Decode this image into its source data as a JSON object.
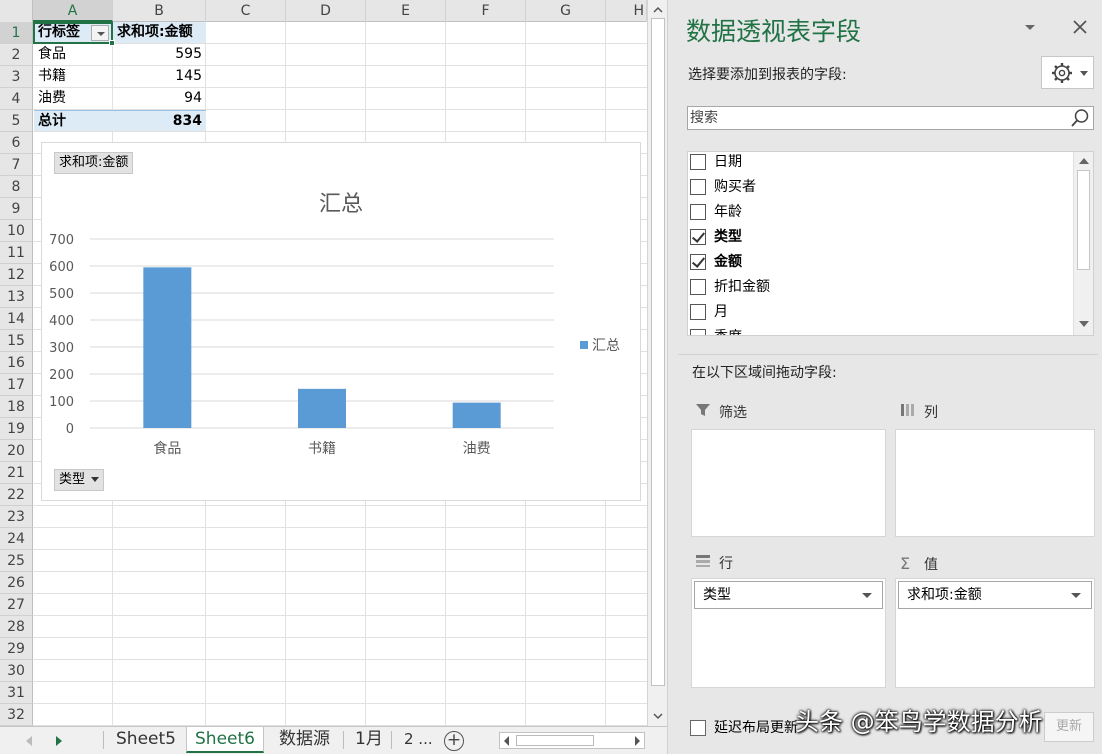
{
  "sheet": {
    "columns": [
      "A",
      "B",
      "C",
      "D",
      "E",
      "F",
      "G",
      "H"
    ],
    "rows": [
      "1",
      "2",
      "3",
      "4",
      "5",
      "6",
      "7",
      "8",
      "9",
      "10",
      "11",
      "12",
      "13",
      "14",
      "15",
      "16",
      "17",
      "18",
      "19",
      "20",
      "21",
      "22",
      "23",
      "24",
      "25",
      "26",
      "27",
      "28",
      "29",
      "30",
      "31",
      "32"
    ],
    "pivot": {
      "header_label": "行标签",
      "header_value": "求和项:金额",
      "rows": [
        {
          "label": "食品",
          "value": "595"
        },
        {
          "label": "书籍",
          "value": "145"
        },
        {
          "label": "油费",
          "value": "94"
        }
      ],
      "total_label": "总计",
      "total_value": "834"
    }
  },
  "chart_data": {
    "type": "bar",
    "title": "汇总",
    "categories": [
      "食品",
      "书籍",
      "油费"
    ],
    "series": [
      {
        "name": "汇总",
        "values": [
          595,
          145,
          94
        ]
      }
    ],
    "yticks": [
      "700",
      "600",
      "500",
      "400",
      "300",
      "200",
      "100",
      "0"
    ],
    "ylim": [
      0,
      700
    ],
    "grid": true,
    "legend": "right",
    "color": "#5b9bd5",
    "value_field_button": "求和项:金额",
    "axis_field_button": "类型"
  },
  "tabs": {
    "items": [
      "Sheet5",
      "Sheet6",
      "数据源",
      "1月",
      "2 ..."
    ],
    "active_index": 1,
    "add_icon": "plus-circle-icon"
  },
  "pane": {
    "title": "数据透视表字段",
    "subtitle": "选择要添加到报表的字段:",
    "search_placeholder": "搜索",
    "fields": [
      {
        "name": "日期",
        "checked": false
      },
      {
        "name": "购买者",
        "checked": false
      },
      {
        "name": "年龄",
        "checked": false
      },
      {
        "name": "类型",
        "checked": true
      },
      {
        "name": "金额",
        "checked": true
      },
      {
        "name": "折扣金额",
        "checked": false
      },
      {
        "name": "月",
        "checked": false
      },
      {
        "name": "季度",
        "checked": false
      }
    ],
    "drag_label": "在以下区域间拖动字段:",
    "areas": {
      "filter": {
        "label": "筛选",
        "icon": "filter-icon"
      },
      "columns": {
        "label": "列",
        "icon": "columns-icon"
      },
      "rows": {
        "label": "行",
        "icon": "rows-icon",
        "field": "类型"
      },
      "values": {
        "label": "值",
        "icon": "sigma-icon",
        "field": "求和项:金额"
      }
    },
    "defer_label": "延迟布局更新",
    "update_label": "更新",
    "close_icon": "close-icon",
    "dropdown_icon": "chevron-down-icon",
    "gear_icon": "gear-icon"
  },
  "watermark": "头条 @笨鸟学数据分析"
}
